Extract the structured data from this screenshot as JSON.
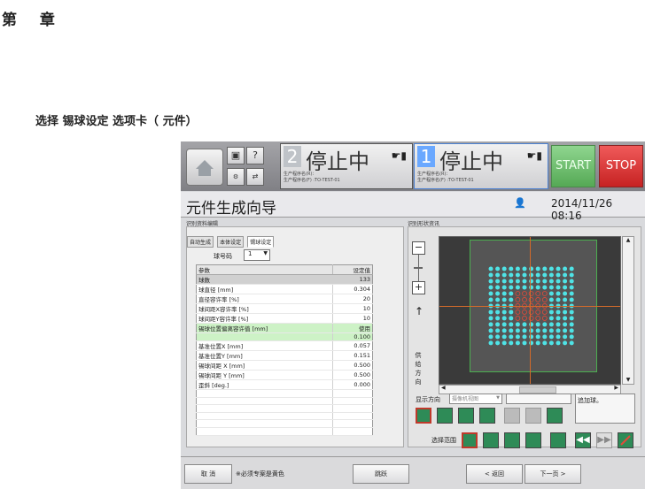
{
  "document": {
    "chapter_heading": "第  章",
    "caption": "选择 锡球设定 选项卡（         元件）"
  },
  "topbar": {
    "lane1": {
      "number": "2",
      "status": "停止中",
      "program_line1": "生产程序名(R)：",
      "program_line2": "生产程序名(F) :TO-TEST-01"
    },
    "lane2": {
      "number": "1",
      "status": "停止中",
      "program_line1": "生产程序名(R)：",
      "program_line2": "生产程序名(F) :TO-TEST-01"
    },
    "help_glyph": "?",
    "start_label": "START",
    "stop_label": "STOP"
  },
  "titlebar": {
    "title": "元件生成向导",
    "datetime": "2014/11/26 08:16"
  },
  "left_panel": {
    "group_label": "识别资料编辑",
    "tabs": [
      "自动生成",
      "本体设定",
      "锡球设定"
    ],
    "active_tab": 2,
    "ball_code_label": "球号码",
    "ball_code_value": "1",
    "table": {
      "headers": [
        "参数",
        "设定值"
      ],
      "rows": [
        {
          "param": "球数",
          "value": "133",
          "style": "gray"
        },
        {
          "param": "球直径 [mm]",
          "value": "0.304",
          "style": ""
        },
        {
          "param": "直径容许率 [%]",
          "value": "20",
          "style": ""
        },
        {
          "param": "球间距X容许率 [%]",
          "value": "10",
          "style": ""
        },
        {
          "param": "球间距Y容许率 [%]",
          "value": "10",
          "style": ""
        },
        {
          "param": "锡球位置偏离容许值 [mm]",
          "value": "使用",
          "style": "green"
        },
        {
          "param": "",
          "value": "0.100",
          "style": "green"
        },
        {
          "param": "基准位置X [mm]",
          "value": "0.057",
          "style": ""
        },
        {
          "param": "基准位置Y [mm]",
          "value": "0.151",
          "style": ""
        },
        {
          "param": "锡球间距 X [mm]",
          "value": "0.500",
          "style": ""
        },
        {
          "param": "锡球间距 Y [mm]",
          "value": "0.500",
          "style": ""
        },
        {
          "param": "歪斜 [deg.]",
          "value": "0.000",
          "style": ""
        },
        {
          "param": "",
          "value": "",
          "style": ""
        },
        {
          "param": "",
          "value": "",
          "style": ""
        },
        {
          "param": "",
          "value": "",
          "style": ""
        },
        {
          "param": "",
          "value": "",
          "style": ""
        },
        {
          "param": "",
          "value": "",
          "style": ""
        },
        {
          "param": "",
          "value": "",
          "style": ""
        }
      ]
    }
  },
  "right_panel": {
    "group_label": "识别形状资讯",
    "feed_direction_label": "供给方向",
    "display_direction_label": "显示方向",
    "display_direction_value": "摄像机视图",
    "message": "追加球。",
    "select_range_label": "选择范围"
  },
  "bottombar": {
    "cancel_label": "取 消",
    "note": "※必须专案是黄色",
    "skip_label": "跳跃",
    "back_label": "< 返回",
    "next_label": "下一页 >"
  },
  "colors": {
    "start_green": "#6cc16c",
    "stop_red": "#d63030",
    "ball_cyan": "#4fe3e6",
    "ball_red": "#e34a3a",
    "highlight_green": "#cdf2c6",
    "selection_green": "#4caf50"
  }
}
